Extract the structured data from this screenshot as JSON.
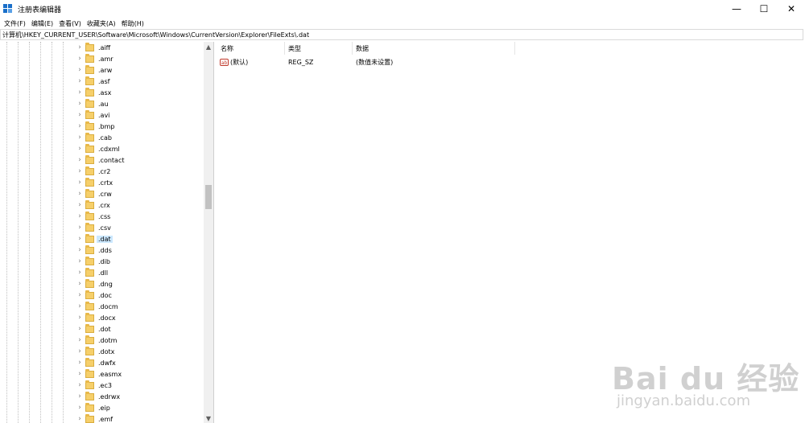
{
  "window": {
    "title": "注册表编辑器",
    "minimize": "—",
    "maximize": "☐",
    "close": "✕"
  },
  "menu": [
    "文件(F)",
    "编辑(E)",
    "查看(V)",
    "收藏夹(A)",
    "帮助(H)"
  ],
  "address": "计算机\\HKEY_CURRENT_USER\\Software\\Microsoft\\Windows\\CurrentVersion\\Explorer\\FileExts\\.dat",
  "tree": {
    "items": [
      ".aiff",
      ".amr",
      ".arw",
      ".asf",
      ".asx",
      ".au",
      ".avi",
      ".bmp",
      ".cab",
      ".cdxml",
      ".contact",
      ".cr2",
      ".crtx",
      ".crw",
      ".crx",
      ".css",
      ".csv",
      ".dat",
      ".dds",
      ".dib",
      ".dll",
      ".dng",
      ".doc",
      ".docm",
      ".docx",
      ".dot",
      ".dotm",
      ".dotx",
      ".dwfx",
      ".easmx",
      ".ec3",
      ".edrwx",
      ".eip",
      ".emf"
    ],
    "selected": ".dat",
    "chevron_glyph": "›"
  },
  "list": {
    "headers": {
      "name": "名称",
      "type": "类型",
      "data": "数据"
    },
    "rows": [
      {
        "name": "(默认)",
        "type": "REG_SZ",
        "data": "(数值未设置)",
        "icon": "ab"
      }
    ]
  },
  "watermark": {
    "main": "Bai du 经验",
    "sub": "jingyan.baidu.com"
  },
  "colors": {
    "selected_bg": "#cce8ff",
    "folder": "#f6cf6a",
    "accent": "#1a6fc9"
  }
}
